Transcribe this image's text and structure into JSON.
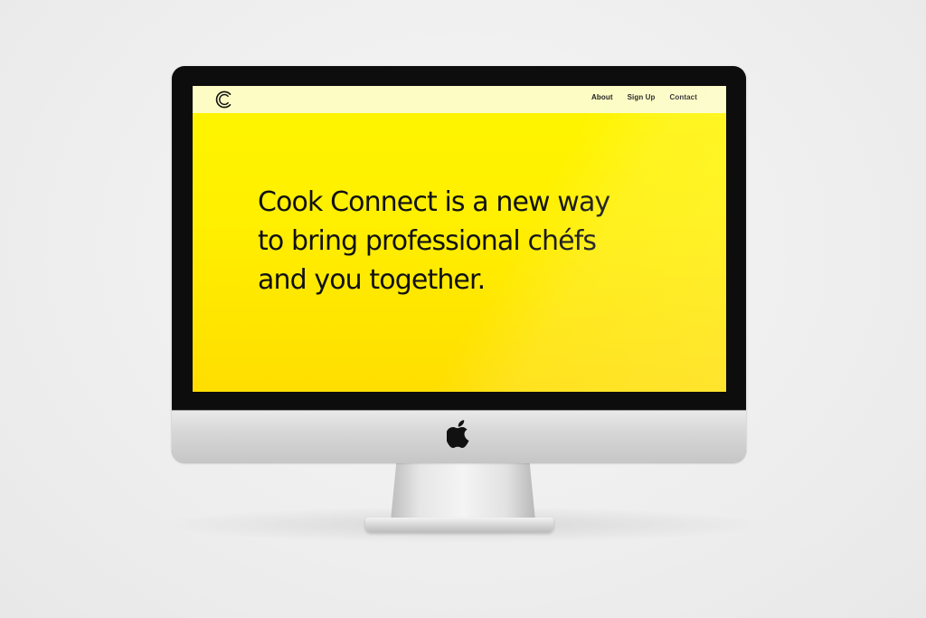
{
  "site": {
    "logo_letter": "C"
  },
  "nav": {
    "items": [
      {
        "label": "About"
      },
      {
        "label": "Sign Up"
      },
      {
        "label": "Contact"
      }
    ]
  },
  "hero": {
    "lines": [
      "Cook Connect is a new way",
      "to bring professional chéfs",
      "and you together."
    ]
  },
  "colors": {
    "screen_top": "#fff600",
    "screen_bottom": "#ffde00",
    "topbar": "#fcfcc4",
    "text": "#111111"
  },
  "icons": [
    "c-logo-icon",
    "apple-logo-icon"
  ]
}
